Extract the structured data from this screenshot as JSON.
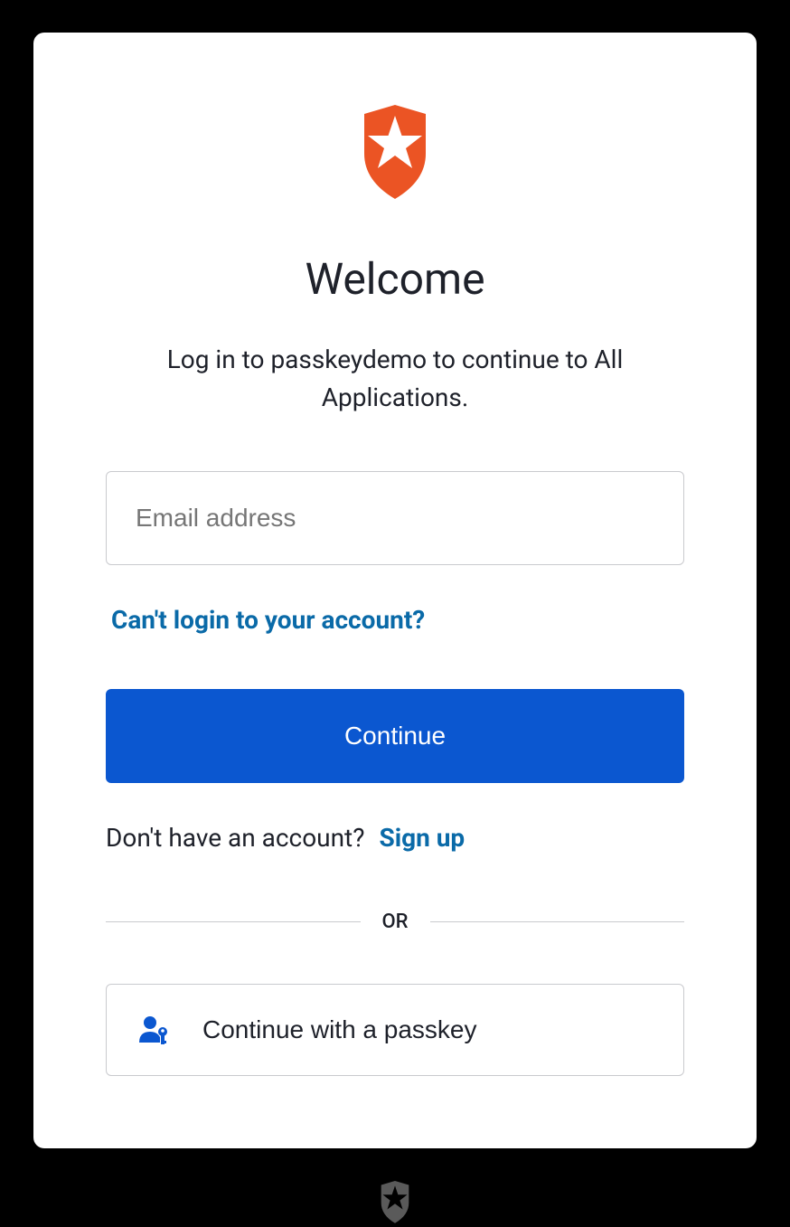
{
  "title": "Welcome",
  "subtitle": "Log in to passkeydemo to continue to All Applications.",
  "form": {
    "email_placeholder": "Email address",
    "email_value": "",
    "help_link": "Can't login to your account?",
    "continue_label": "Continue"
  },
  "signup": {
    "prompt": "Don't have an account?",
    "link": "Sign up"
  },
  "divider_label": "OR",
  "passkey": {
    "label": "Continue with a passkey"
  },
  "colors": {
    "brand_orange": "#EB5424",
    "primary_blue": "#0b57d0",
    "link_teal": "#0a6aa8"
  }
}
